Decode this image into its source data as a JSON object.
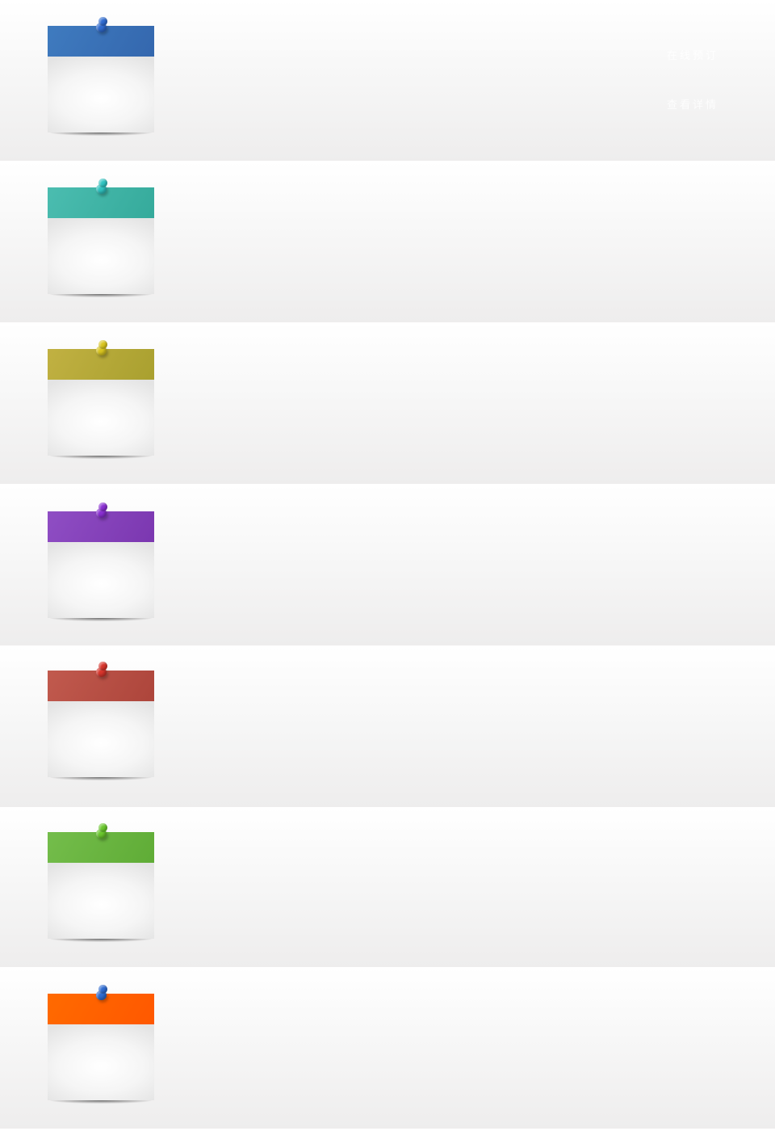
{
  "links": {
    "book_online": "在线预订",
    "view_details": "查看详情"
  },
  "notes": [
    {
      "band_color": "#3f7bbf",
      "band_color_end": "#3467ae",
      "pin_color": "#2f6bd0",
      "pin_icon": "pushpin-icon"
    },
    {
      "band_color": "#4bbdb0",
      "band_color_end": "#35aa9b",
      "pin_color": "#2fc3c0",
      "pin_icon": "pushpin-icon"
    },
    {
      "band_color": "#c1b142",
      "band_color_end": "#a9a02f",
      "pin_color": "#d9c520",
      "pin_icon": "pushpin-icon"
    },
    {
      "band_color": "#8f4ec4",
      "band_color_end": "#7b37b0",
      "pin_color": "#8a2fd2",
      "pin_icon": "pushpin-icon"
    },
    {
      "band_color": "#c15a4e",
      "band_color_end": "#ad453b",
      "pin_color": "#d8352c",
      "pin_icon": "pushpin-icon"
    },
    {
      "band_color": "#74bd4b",
      "band_color_end": "#5fac36",
      "pin_color": "#6ac72d",
      "pin_icon": "pushpin-icon"
    },
    {
      "band_color": "#ff6a00",
      "band_color_end": "#ff5800",
      "pin_color": "#2f6bd0",
      "pin_icon": "pushpin-icon"
    }
  ]
}
